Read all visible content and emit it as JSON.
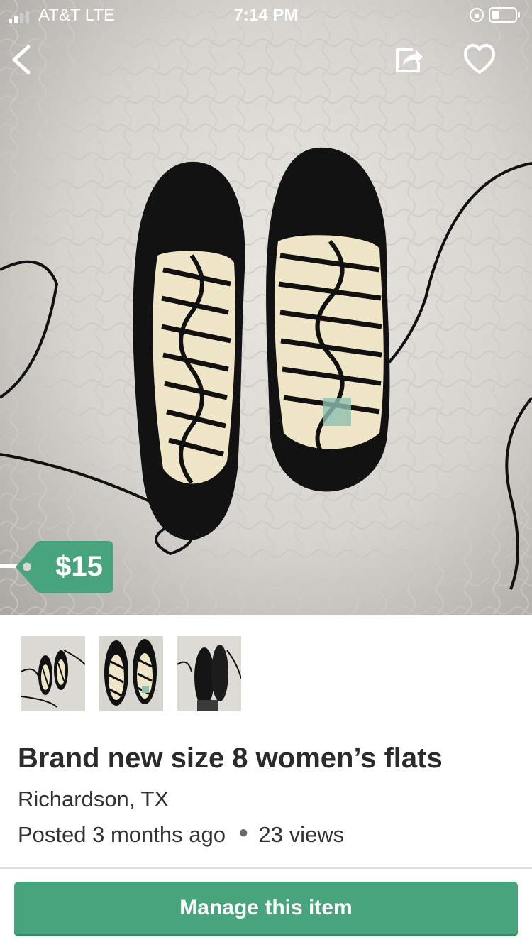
{
  "status_bar": {
    "carrier": "AT&T  LTE",
    "time": "7:14 PM"
  },
  "nav": {
    "back_icon": "chevron-left-icon",
    "share_icon": "share-icon",
    "favorite_icon": "heart-icon"
  },
  "listing": {
    "price": "$15",
    "title": "Brand new size 8 women’s flats",
    "location": "Richardson, TX",
    "posted": "Posted 3 months ago",
    "views": "23 views",
    "thumbnail_count": 3
  },
  "actions": {
    "manage_label": "Manage this item"
  },
  "colors": {
    "accent_green": "#48a47c",
    "title_text": "#2b2b2b",
    "body_text": "#333333"
  }
}
